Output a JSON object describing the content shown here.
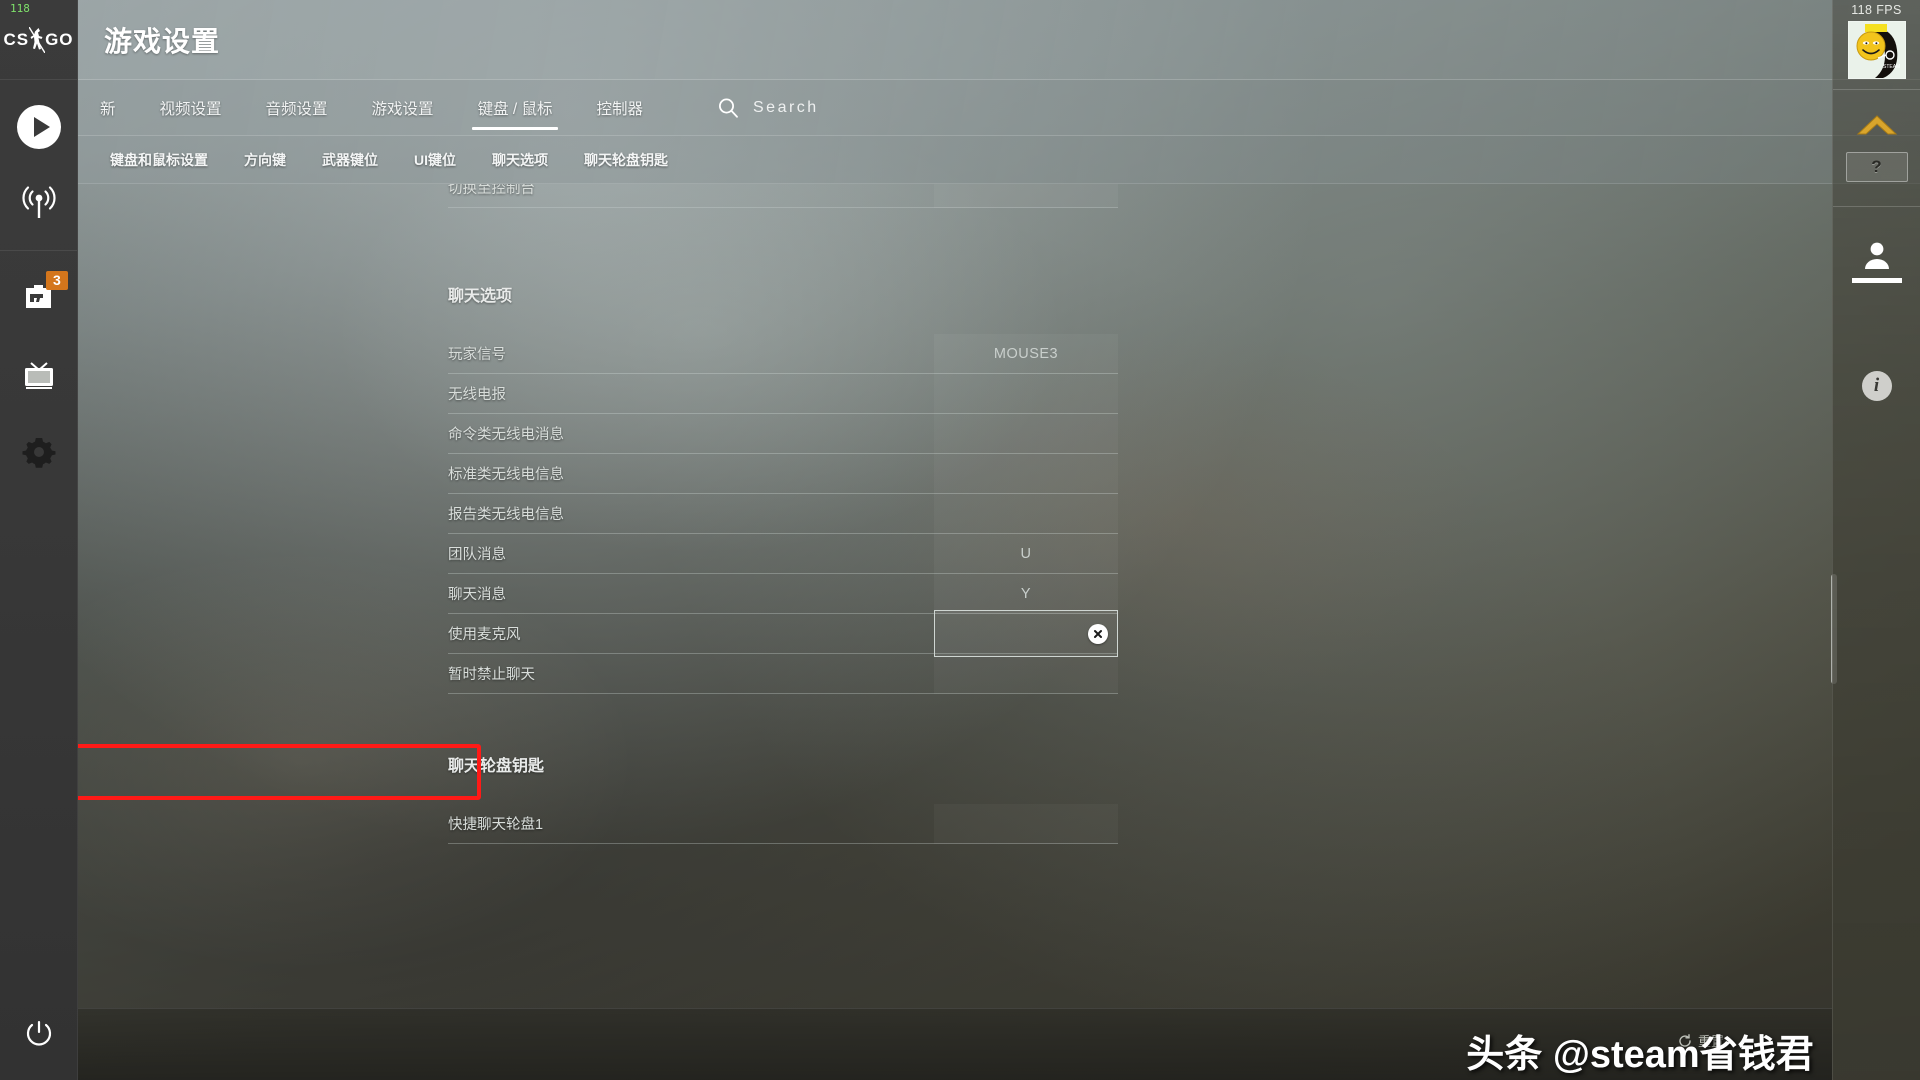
{
  "app": {
    "logo_text_left": "CS",
    "logo_text_right": "GO",
    "page_title": "游戏设置",
    "fps_corner": "118",
    "fps_counter": "118 FPS"
  },
  "left_rail": {
    "items": [
      {
        "name": "play",
        "icon": "play-icon",
        "badge": null
      },
      {
        "name": "broadcast",
        "icon": "broadcast-icon",
        "badge": null
      },
      {
        "name": "inventory",
        "icon": "inventory-icon",
        "badge": "3"
      },
      {
        "name": "watch",
        "icon": "tv-icon",
        "badge": null
      },
      {
        "name": "settings",
        "icon": "gear-icon",
        "badge": null
      }
    ],
    "power_label": "power-icon"
  },
  "tabs": [
    {
      "label": "新",
      "active": false
    },
    {
      "label": "视频设置",
      "active": false
    },
    {
      "label": "音频设置",
      "active": false
    },
    {
      "label": "游戏设置",
      "active": false
    },
    {
      "label": "键盘 / 鼠标",
      "active": true
    },
    {
      "label": "控制器",
      "active": false
    }
  ],
  "search": {
    "label": "Search",
    "placeholder": "Search",
    "value": ""
  },
  "subtabs": [
    {
      "label": "键盘和鼠标设置"
    },
    {
      "label": "方向键"
    },
    {
      "label": "武器键位"
    },
    {
      "label": "UI键位"
    },
    {
      "label": "聊天选项"
    },
    {
      "label": "聊天轮盘钥匙"
    }
  ],
  "content": {
    "partial_row": {
      "label": "切换至控制台",
      "value": "`"
    },
    "sections": [
      {
        "title": "聊天选项",
        "rows": [
          {
            "label": "玩家信号",
            "value": "MOUSE3",
            "editing": false,
            "highlighted": false
          },
          {
            "label": "无线电报",
            "value": "",
            "editing": false,
            "highlighted": false
          },
          {
            "label": "命令类无线电消息",
            "value": "",
            "editing": false,
            "highlighted": false
          },
          {
            "label": "标准类无线电信息",
            "value": "",
            "editing": false,
            "highlighted": false
          },
          {
            "label": "报告类无线电信息",
            "value": "",
            "editing": false,
            "highlighted": false
          },
          {
            "label": "团队消息",
            "value": "U",
            "editing": false,
            "highlighted": false
          },
          {
            "label": "聊天消息",
            "value": "Y",
            "editing": false,
            "highlighted": false
          },
          {
            "label": "使用麦克风",
            "value": "",
            "editing": true,
            "highlighted": true
          },
          {
            "label": "暂时禁止聊天",
            "value": "",
            "editing": false,
            "highlighted": false
          }
        ]
      },
      {
        "title": "聊天轮盘钥匙",
        "rows": [
          {
            "label": "快捷聊天轮盘1",
            "value": "",
            "editing": false,
            "highlighted": false
          }
        ]
      }
    ],
    "clear_button_label": "clear-icon"
  },
  "right_rail": {
    "help_label": "?",
    "rank_icon": "rank-chevron-icon",
    "friends_icon": "person-icon",
    "info_icon": "info-icon",
    "avatar": "steam-smiley-avatar"
  },
  "bottom": {
    "reset_label": "重置",
    "watermark": "头条 @steam省钱君"
  },
  "colors": {
    "highlight_border": "#ff1a17",
    "badge_orange": "#d4761c",
    "accent_white": "#ffffff",
    "rank_gold": "#d9a52c"
  }
}
